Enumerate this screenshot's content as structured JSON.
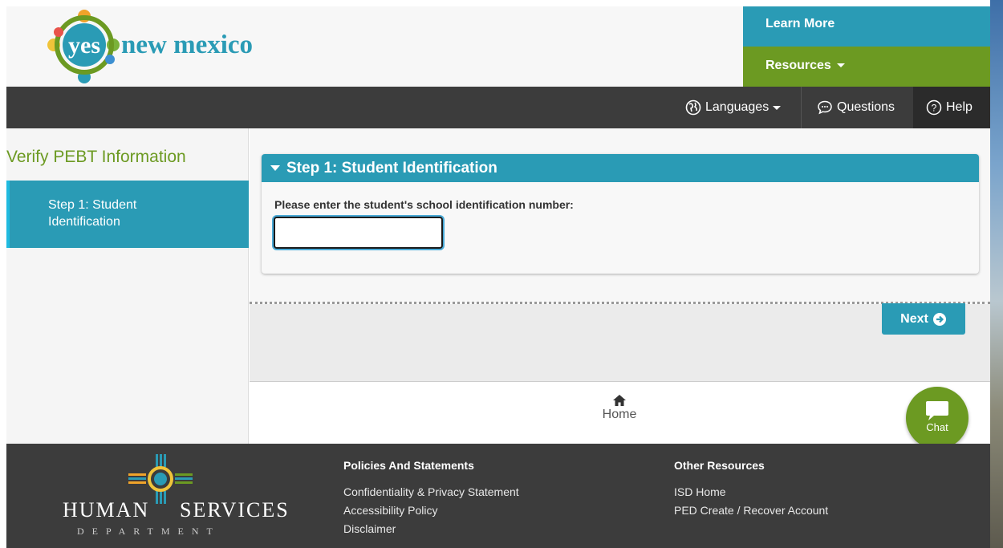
{
  "header": {
    "logo_text": "yes new mexico",
    "learn_more": "Learn More",
    "resources": "Resources"
  },
  "nav": {
    "languages": "Languages",
    "questions": "Questions",
    "help": "Help"
  },
  "sidebar": {
    "title": "Verify PEBT Information",
    "steps": [
      {
        "label": "Step 1: Student Identification"
      }
    ]
  },
  "main": {
    "panel_title": "Step 1: Student Identification",
    "field_label": "Please enter the student's school identification number:",
    "field_value": "",
    "next_label": "Next",
    "home_label": "Home",
    "chat_label": "Chat"
  },
  "footer": {
    "org_name_1": "HUMAN",
    "org_name_2": "SERVICES",
    "org_sub": "DEPARTMENT",
    "policies_title": "Policies And Statements",
    "policies_links": [
      "Confidentiality & Privacy Statement",
      "Accessibility Policy",
      "Disclaimer"
    ],
    "other_title": "Other Resources",
    "other_links": [
      "ISD Home",
      "PED Create / Recover Account"
    ]
  },
  "colors": {
    "teal": "#2a9bb5",
    "green": "#6c9a22",
    "dark": "#3c3c3c"
  }
}
